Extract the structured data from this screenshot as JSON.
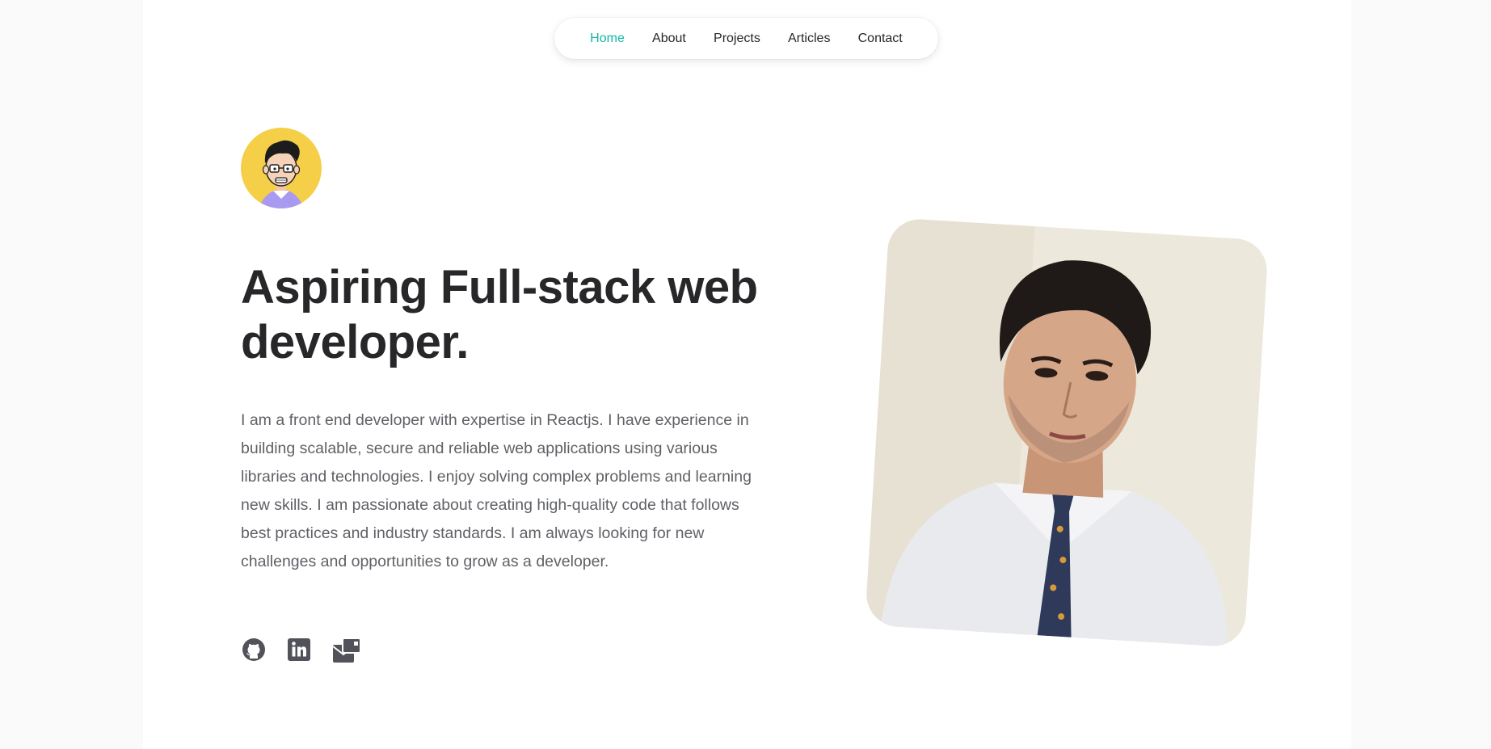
{
  "nav": {
    "items": [
      {
        "label": "Home",
        "active": true
      },
      {
        "label": "About",
        "active": false
      },
      {
        "label": "Projects",
        "active": false
      },
      {
        "label": "Articles",
        "active": false
      },
      {
        "label": "Contact",
        "active": false
      }
    ]
  },
  "hero": {
    "title": "Aspiring Full-stack web developer.",
    "bio": "I am a front end developer with expertise in Reactjs. I have experience in building scalable, secure and reliable web applications using various libraries and technologies. I enjoy solving complex problems and learning new skills. I am passionate about creating high-quality code that follows best practices and industry standards. I am always looking for new challenges and opportunities to grow as a developer.",
    "socials": [
      {
        "icon": "github-icon"
      },
      {
        "icon": "linkedin-icon"
      },
      {
        "icon": "mail-icon"
      }
    ]
  },
  "colors": {
    "accent": "#14b8a6",
    "text": "#27272a",
    "muted": "#5f6166",
    "avatar_bg": "#f5cf48"
  }
}
